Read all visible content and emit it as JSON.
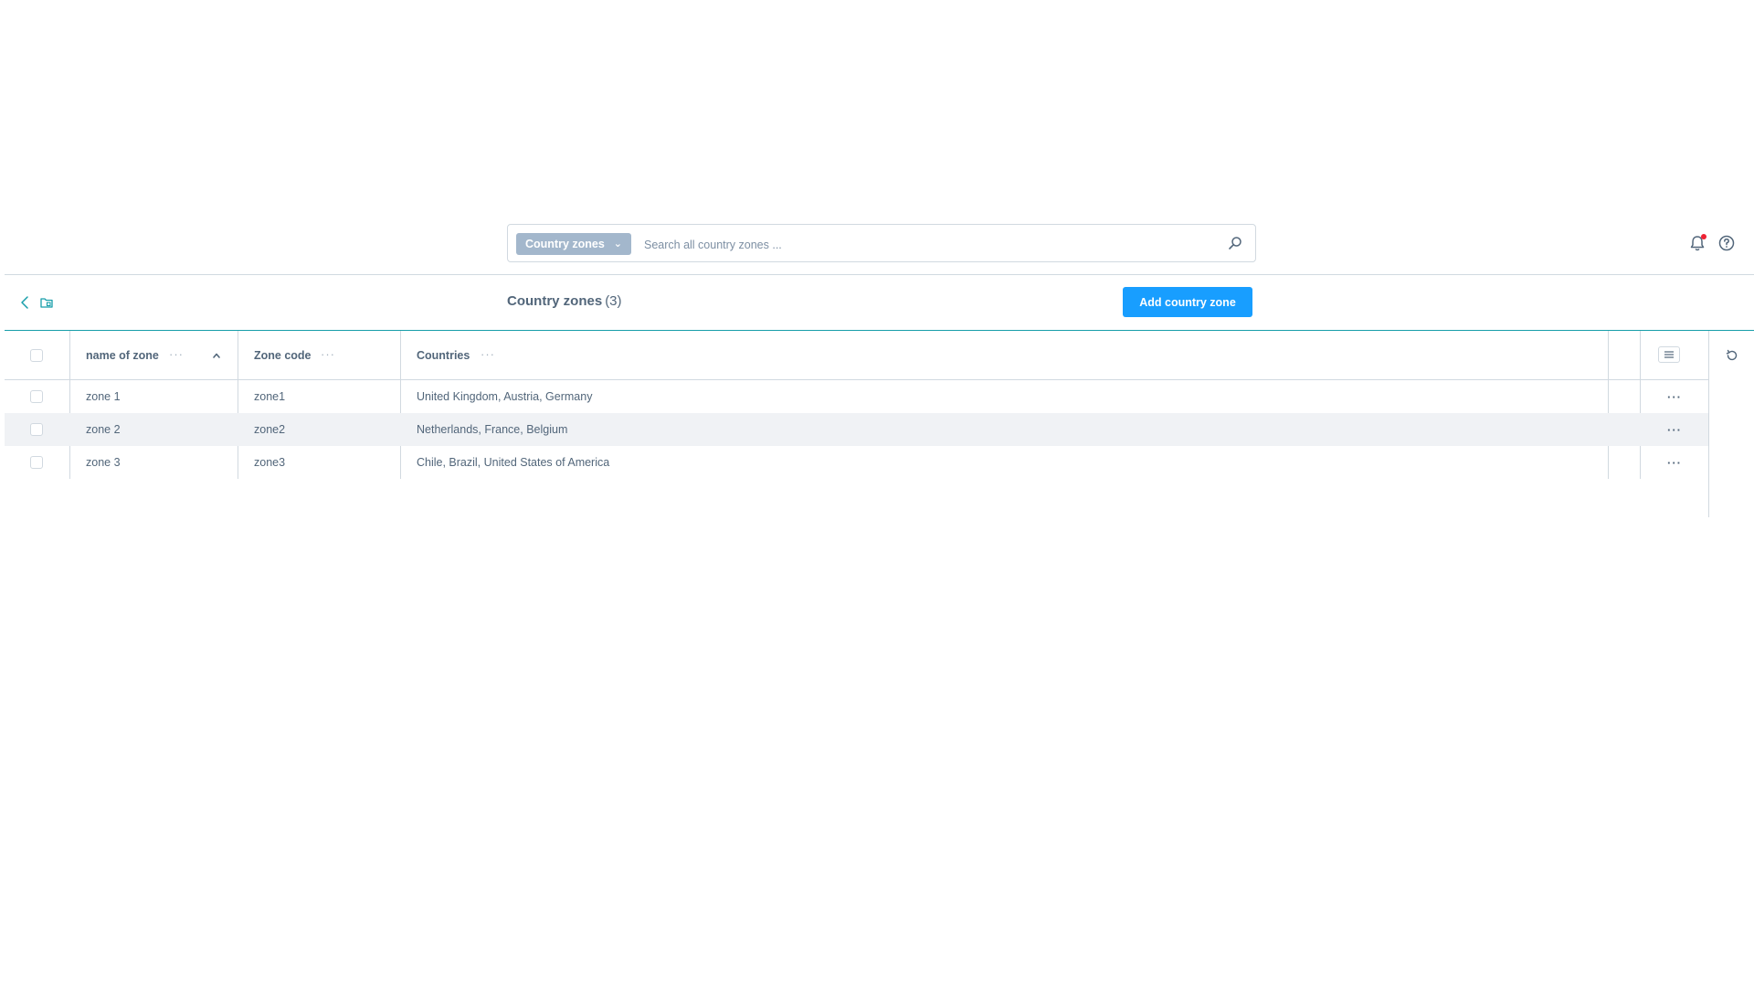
{
  "search": {
    "type_label": "Country zones",
    "placeholder": "Search all country zones ..."
  },
  "header": {
    "title": "Country zones",
    "count": "(3)",
    "add_button": "Add country zone"
  },
  "grid": {
    "columns": [
      {
        "label": "name of zone",
        "sorted": "ascending"
      },
      {
        "label": "Zone code"
      },
      {
        "label": "Countries"
      }
    ],
    "rows": [
      {
        "name": "zone 1",
        "code": "zone1",
        "countries": "United Kingdom, Austria, Germany"
      },
      {
        "name": "zone 2",
        "code": "zone2",
        "countries": "Netherlands, France, Belgium"
      },
      {
        "name": "zone 3",
        "code": "zone3",
        "countries": "Chile, Brazil, United States of America"
      }
    ],
    "row_actions_label": "···",
    "column_actions_label": "···"
  },
  "colors": {
    "accent": "#189eff",
    "divider_active": "#189eaa",
    "type_select_bg": "#a3b7cc",
    "notification_dot": "#ee2233"
  },
  "icons": {
    "search": "magnifier-icon",
    "bell": "bell-icon",
    "help": "help-icon",
    "back": "chevron-left-icon",
    "folder": "folder-icon",
    "sort": "chevron-up-icon",
    "settings": "list-settings-icon",
    "reset": "reset-icon"
  }
}
